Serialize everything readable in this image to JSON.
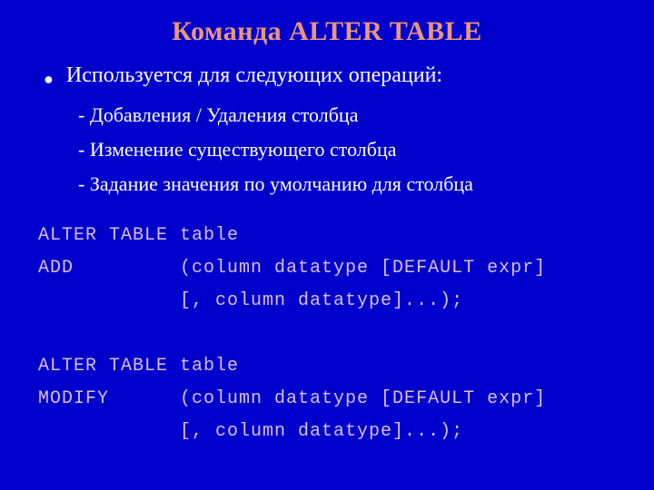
{
  "title": "Команда ALTER TABLE",
  "intro": "Используется для следующих операций:",
  "ops": [
    "Добавления / Удаления столбца",
    "Изменение существующего столбца",
    "Задание значения по умолчанию для столбца"
  ],
  "code": {
    "l1": "ALTER TABLE table",
    "l2": "ADD         (column datatype [DEFAULT expr]",
    "l3": "            [, column datatype]...);",
    "l4": "",
    "l5": "ALTER TABLE table",
    "l6": "MODIFY      (column datatype [DEFAULT expr]",
    "l7": "            [, column datatype]...);"
  },
  "dash": "-"
}
